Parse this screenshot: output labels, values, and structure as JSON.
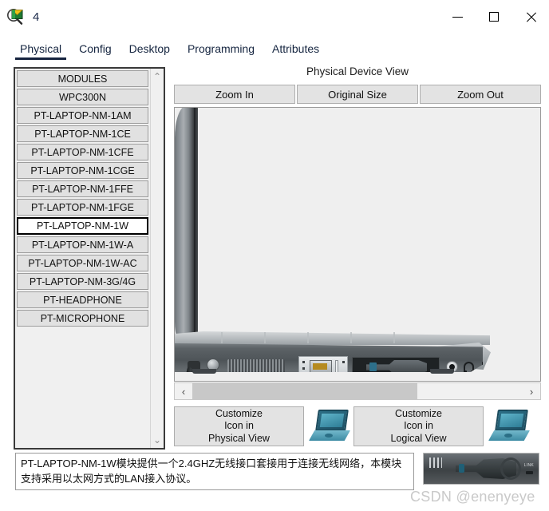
{
  "window": {
    "title": "4",
    "icon": "magnifier-device-icon",
    "controls": {
      "minimize": "minimize-icon",
      "maximize": "maximize-icon",
      "close": "close-icon"
    }
  },
  "tabs": [
    {
      "label": "Physical",
      "active": true
    },
    {
      "label": "Config",
      "active": false
    },
    {
      "label": "Desktop",
      "active": false
    },
    {
      "label": "Programming",
      "active": false
    },
    {
      "label": "Attributes",
      "active": false
    }
  ],
  "modules": {
    "header": "MODULES",
    "items": [
      {
        "label": "MODULES",
        "selected": false
      },
      {
        "label": "WPC300N",
        "selected": false
      },
      {
        "label": "PT-LAPTOP-NM-1AM",
        "selected": false
      },
      {
        "label": "PT-LAPTOP-NM-1CE",
        "selected": false
      },
      {
        "label": "PT-LAPTOP-NM-1CFE",
        "selected": false
      },
      {
        "label": "PT-LAPTOP-NM-1CGE",
        "selected": false
      },
      {
        "label": "PT-LAPTOP-NM-1FFE",
        "selected": false
      },
      {
        "label": "PT-LAPTOP-NM-1FGE",
        "selected": false
      },
      {
        "label": "PT-LAPTOP-NM-1W",
        "selected": true
      },
      {
        "label": "PT-LAPTOP-NM-1W-A",
        "selected": false
      },
      {
        "label": "PT-LAPTOP-NM-1W-AC",
        "selected": false
      },
      {
        "label": "PT-LAPTOP-NM-3G/4G",
        "selected": false
      },
      {
        "label": "PT-HEADPHONE",
        "selected": false
      },
      {
        "label": "PT-MICROPHONE",
        "selected": false
      }
    ],
    "scroll_up": "⌃",
    "scroll_down": "⌄"
  },
  "device_view": {
    "title": "Physical Device View",
    "zoom_in": "Zoom In",
    "original_size": "Original Size",
    "zoom_out": "Zoom Out",
    "hscroll_left": "‹",
    "hscroll_right": "›"
  },
  "customize": {
    "physical_line1": "Customize",
    "physical_line2": "Icon in",
    "physical_line3": "Physical View",
    "logical_line1": "Customize",
    "logical_line2": "Icon in",
    "logical_line3": "Logical View",
    "icon_physical": "laptop-icon",
    "icon_logical": "laptop-icon"
  },
  "description": {
    "text": "PT-LAPTOP-NM-1W模块提供一个2.4GHZ无线接口套接用于连接无线网络，本模块支持采用以太网方式的LAN接入协议。"
  },
  "watermark": {
    "text": "CSDN @enenyeye"
  },
  "colors": {
    "accent": "#16243f",
    "panel_bg": "#f0f0f0",
    "button_bg": "#e3e3e3",
    "list_item_bg": "#e1e1e1",
    "selected_bg": "#ffffff",
    "device_bg": "#efefef",
    "laptop_icon": "#2c6f86"
  }
}
